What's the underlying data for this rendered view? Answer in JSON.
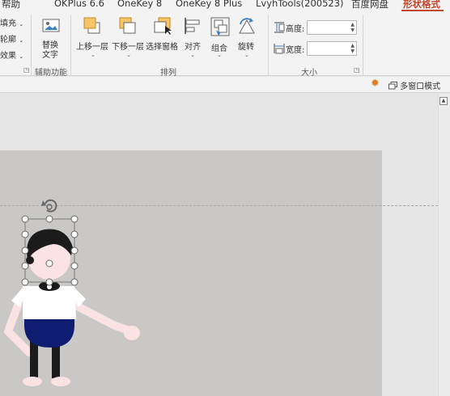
{
  "tabs": [
    {
      "label": "帮助",
      "active": false
    },
    {
      "label": "OKPlus 6.6",
      "active": false
    },
    {
      "label": "OneKey 8",
      "active": false
    },
    {
      "label": "OneKey 8 Plus",
      "active": false
    },
    {
      "label": "LvyhTools(200523)",
      "active": false
    },
    {
      "label": "百度网盘",
      "active": false
    },
    {
      "label": "形状格式",
      "active": true
    }
  ],
  "colors": {
    "accent": "#c4452b",
    "slide": "#c9c8c6",
    "ribbon": "#f3f3f3"
  },
  "shape_styles": {
    "fill_label": "填充",
    "outline_label": "轮廓",
    "effect_label": "效果"
  },
  "accessibility": {
    "alt_text_line1": "替换",
    "alt_text_line2": "文字",
    "group_label": "辅助功能"
  },
  "arrange": {
    "bring_forward": "上移一层",
    "send_backward": "下移一层",
    "selection_pane": "选择窗格",
    "align": "对齐",
    "group": "组合",
    "rotate": "旋转",
    "group_label": "排列"
  },
  "size": {
    "height_label": "高度:",
    "width_label": "宽度:",
    "height_value": "",
    "width_value": "",
    "group_label": "大小"
  },
  "subbar": {
    "multi_window": "多窗口模式"
  },
  "icons": {
    "settings": "gear-icon",
    "window": "window-icon",
    "rotate_handle": "rotate-handle-icon"
  }
}
